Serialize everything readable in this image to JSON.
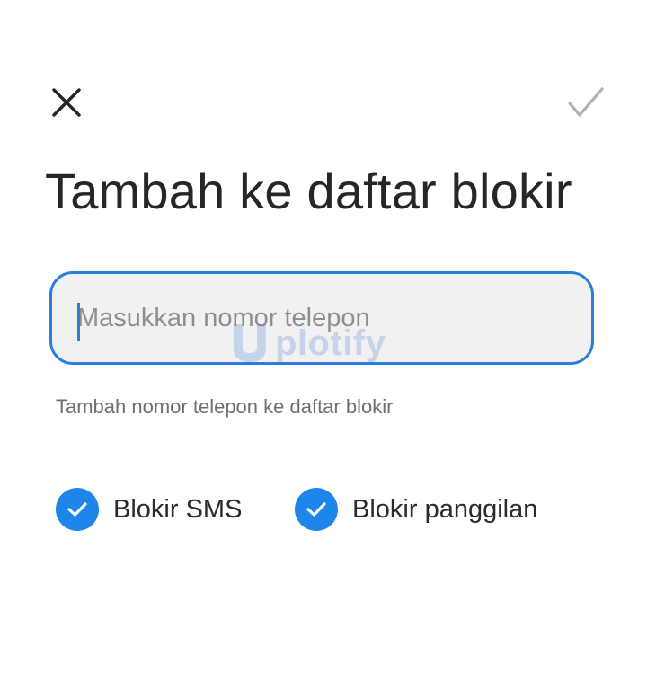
{
  "toolbar": {
    "close_icon": "close-icon",
    "confirm_icon": "checkmark-icon"
  },
  "header": {
    "title": "Tambah ke daftar blokir"
  },
  "phone_input": {
    "placeholder": "Masukkan nomor telepon",
    "value": ""
  },
  "helper_text": "Tambah nomor telepon ke daftar blokir",
  "options": [
    {
      "label": "Blokir SMS",
      "checked": true
    },
    {
      "label": "Blokir panggilan",
      "checked": true
    }
  ],
  "watermark": {
    "text": "plotify"
  },
  "colors": {
    "accent": "#1e86e8",
    "field_border": "#2a7fdc",
    "field_background": "#f1f1f1",
    "disabled_check": "#b0b0b0"
  }
}
